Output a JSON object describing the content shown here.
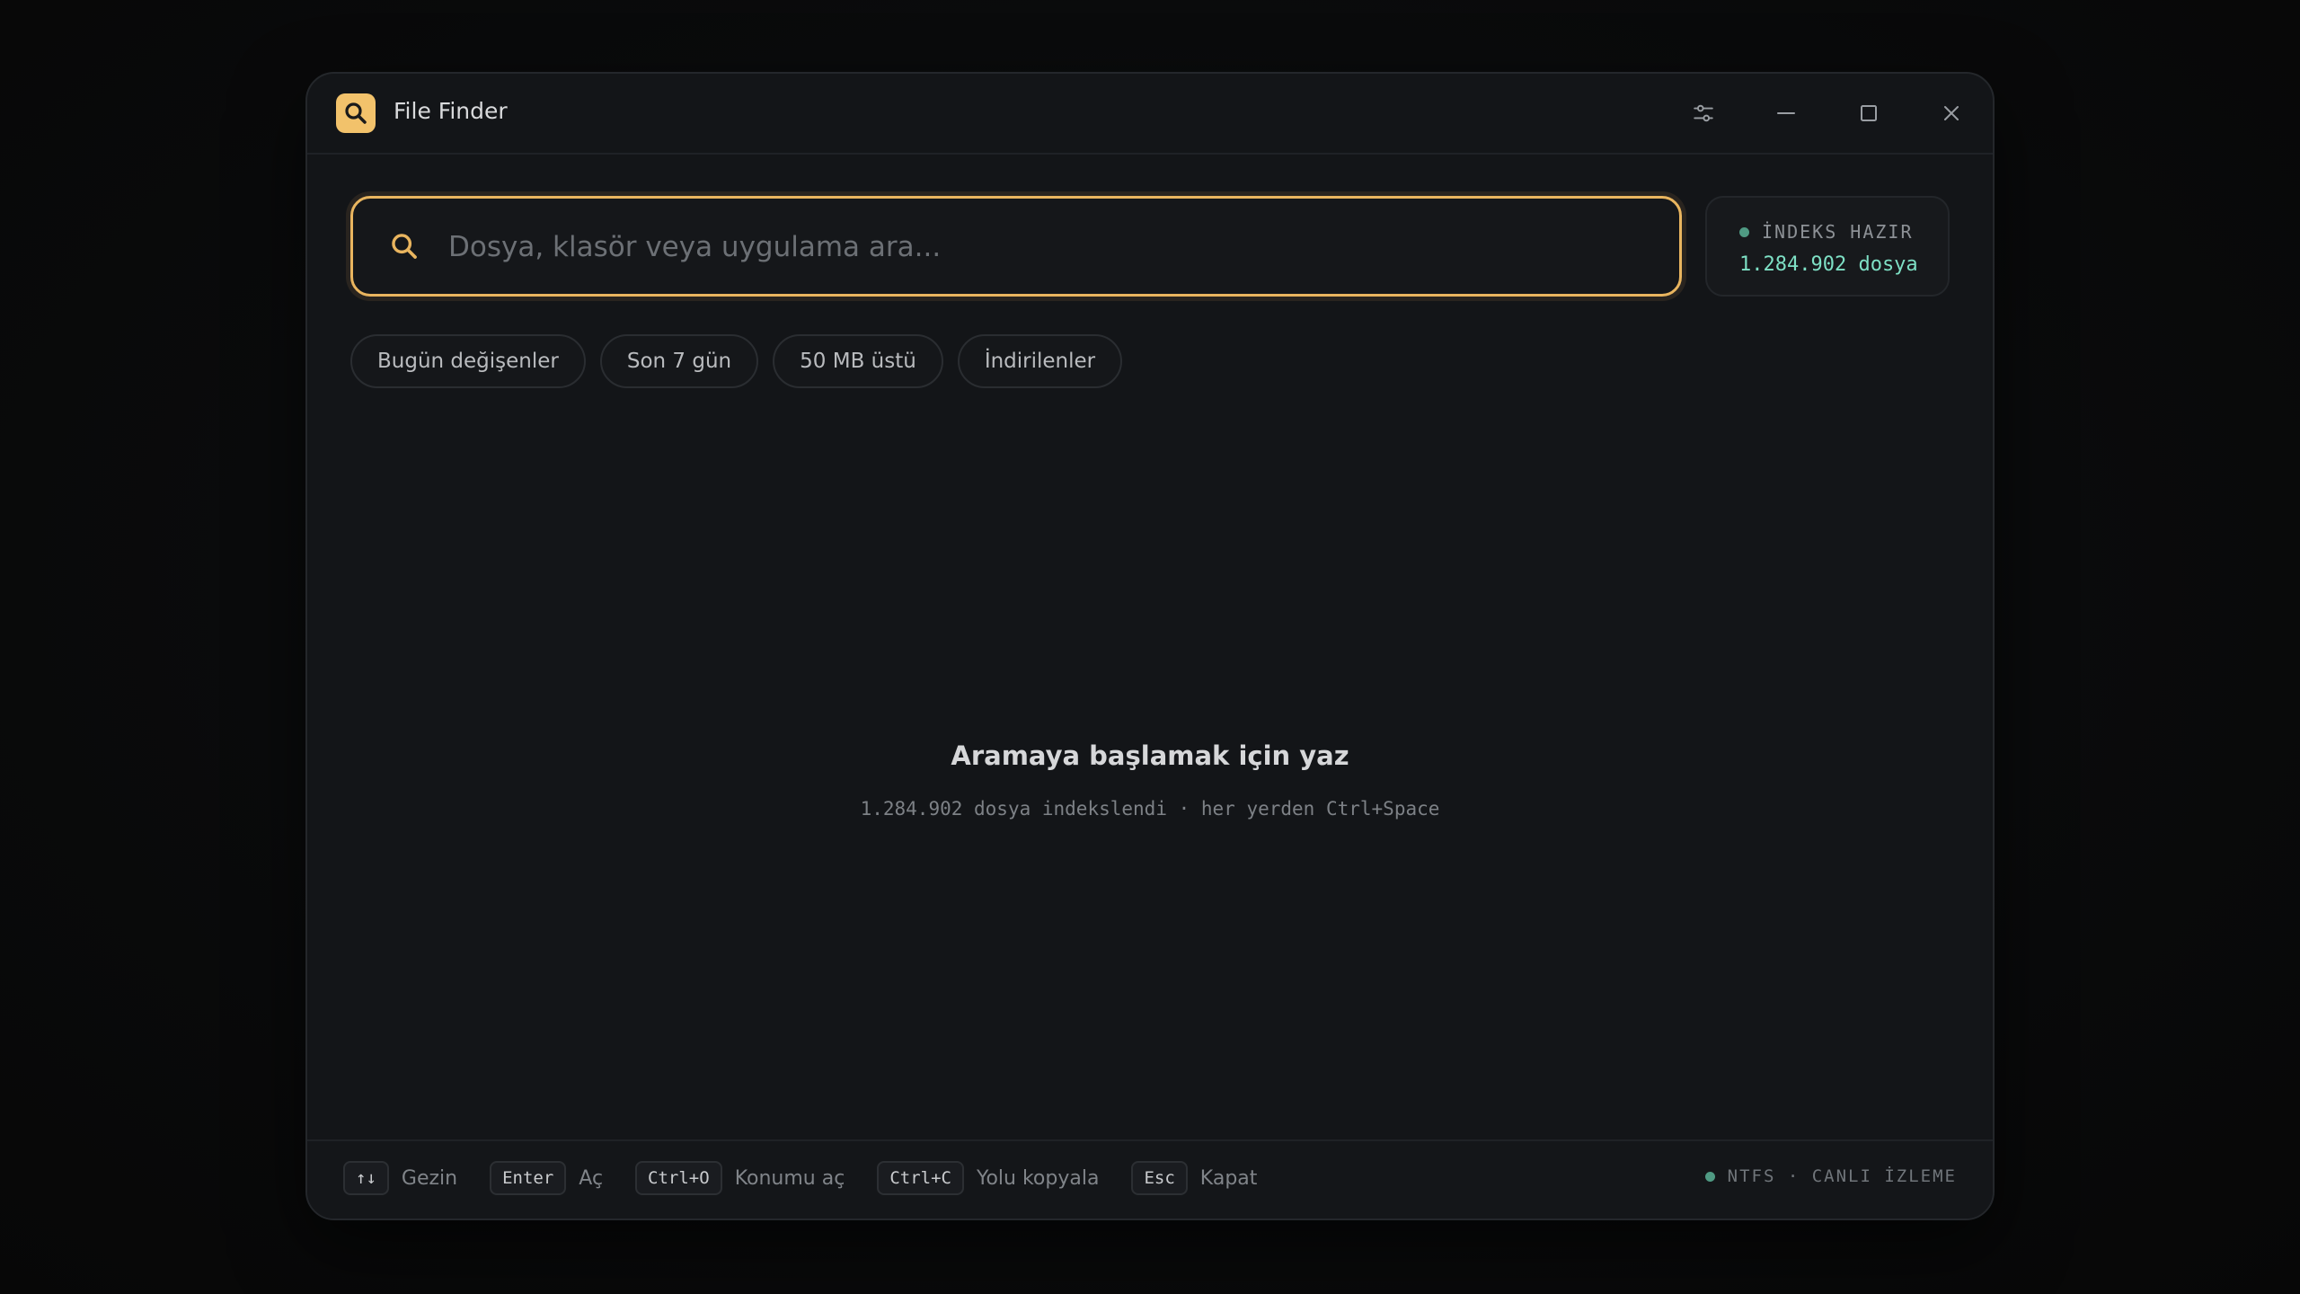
{
  "app": {
    "title": "File Finder",
    "icon": "search-icon"
  },
  "titlebar": {
    "settings_icon": "sliders-icon",
    "minimize_icon": "minimize-icon",
    "maximize_icon": "maximize-icon",
    "close_icon": "close-icon"
  },
  "search": {
    "placeholder": "Dosya, klasör veya uygulama ara...",
    "value": ""
  },
  "index": {
    "status": "İNDEKS HAZIR",
    "count": "1.284.902 dosya"
  },
  "filters": [
    {
      "label": "Bugün değişenler"
    },
    {
      "label": "Son 7 gün"
    },
    {
      "label": "50 MB üstü"
    },
    {
      "label": "İndirilenler"
    }
  ],
  "empty_state": {
    "title": "Aramaya başlamak için yaz",
    "subtitle": "1.284.902 dosya indekslendi · her yerden Ctrl+Space"
  },
  "footer": {
    "shortcuts": [
      {
        "key": "↑↓",
        "label": "Gezin"
      },
      {
        "key": "Enter",
        "label": "Aç"
      },
      {
        "key": "Ctrl+O",
        "label": "Konumu aç"
      },
      {
        "key": "Ctrl+C",
        "label": "Yolu kopyala"
      },
      {
        "key": "Esc",
        "label": "Kapat"
      }
    ],
    "status": "NTFS · CANLI İZLEME"
  },
  "colors": {
    "accent": "#e9b55f",
    "status_green": "#4f9a83",
    "count_teal": "#7ee0c5",
    "background": "#131518"
  }
}
